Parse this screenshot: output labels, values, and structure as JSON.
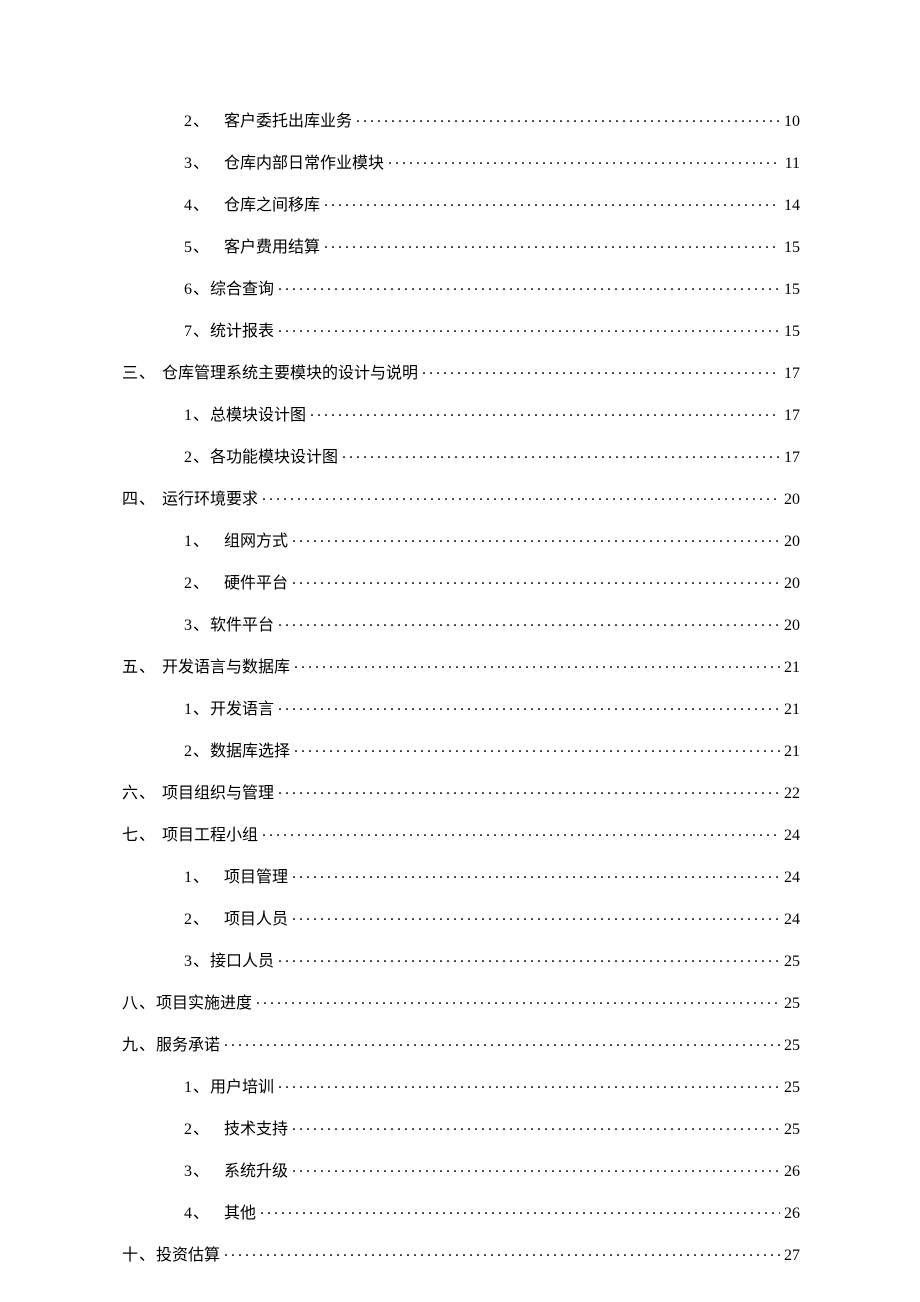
{
  "toc": [
    {
      "level": 2,
      "num": "2、",
      "wide": true,
      "title": "客户委托出库业务",
      "page": "10"
    },
    {
      "level": 2,
      "num": "3、",
      "wide": true,
      "title": "仓库内部日常作业模块",
      "page": "11"
    },
    {
      "level": 2,
      "num": "4、",
      "wide": true,
      "title": "仓库之间移库",
      "page": "14"
    },
    {
      "level": 2,
      "num": "5、",
      "wide": true,
      "title": "客户费用结算",
      "page": "15"
    },
    {
      "level": 2,
      "num": "6、",
      "wide": false,
      "title": "综合查询",
      "page": "15"
    },
    {
      "level": 2,
      "num": "7、",
      "wide": false,
      "title": "统计报表",
      "page": "15"
    },
    {
      "level": 1,
      "num": "三、",
      "wide": true,
      "title": "仓库管理系统主要模块的设计与说明",
      "page": "17"
    },
    {
      "level": 2,
      "num": "1、",
      "wide": false,
      "title": "总模块设计图",
      "page": "17"
    },
    {
      "level": 2,
      "num": "2、",
      "wide": false,
      "title": "各功能模块设计图",
      "page": "17"
    },
    {
      "level": 1,
      "num": "四、",
      "wide": true,
      "title": "运行环境要求",
      "page": "20"
    },
    {
      "level": 2,
      "num": "1、",
      "wide": true,
      "title": "组网方式",
      "page": "20"
    },
    {
      "level": 2,
      "num": "2、",
      "wide": true,
      "title": "硬件平台",
      "page": "20"
    },
    {
      "level": 2,
      "num": "3、",
      "wide": false,
      "title": "软件平台",
      "page": "20"
    },
    {
      "level": 1,
      "num": "五、",
      "wide": true,
      "title": "开发语言与数据库",
      "page": "21"
    },
    {
      "level": 2,
      "num": "1、",
      "wide": false,
      "title": "开发语言",
      "page": "21"
    },
    {
      "level": 2,
      "num": "2、",
      "wide": false,
      "title": "数据库选择",
      "page": "21"
    },
    {
      "level": 1,
      "num": "六、",
      "wide": true,
      "title": "项目组织与管理",
      "page": "22"
    },
    {
      "level": 1,
      "num": "七、",
      "wide": true,
      "title": "项目工程小组",
      "page": "24"
    },
    {
      "level": 2,
      "num": "1、",
      "wide": true,
      "title": "项目管理",
      "page": "24"
    },
    {
      "level": 2,
      "num": "2、",
      "wide": true,
      "title": "项目人员",
      "page": "24"
    },
    {
      "level": 2,
      "num": "3、",
      "wide": false,
      "title": "接口人员",
      "page": "25"
    },
    {
      "level": 1,
      "num": "八、",
      "wide": false,
      "title": "项目实施进度",
      "page": "25"
    },
    {
      "level": 1,
      "num": "九、",
      "wide": false,
      "title": "服务承诺",
      "page": "25"
    },
    {
      "level": 2,
      "num": "1、",
      "wide": false,
      "title": "用户培训",
      "page": "25"
    },
    {
      "level": 2,
      "num": "2、",
      "wide": true,
      "title": "技术支持",
      "page": "25"
    },
    {
      "level": 2,
      "num": "3、",
      "wide": true,
      "title": "系统升级",
      "page": "26"
    },
    {
      "level": 2,
      "num": "4、",
      "wide": true,
      "title": "其他",
      "page": "26"
    },
    {
      "level": 1,
      "num": "十、",
      "wide": false,
      "title": "投资估算",
      "page": "27"
    }
  ]
}
